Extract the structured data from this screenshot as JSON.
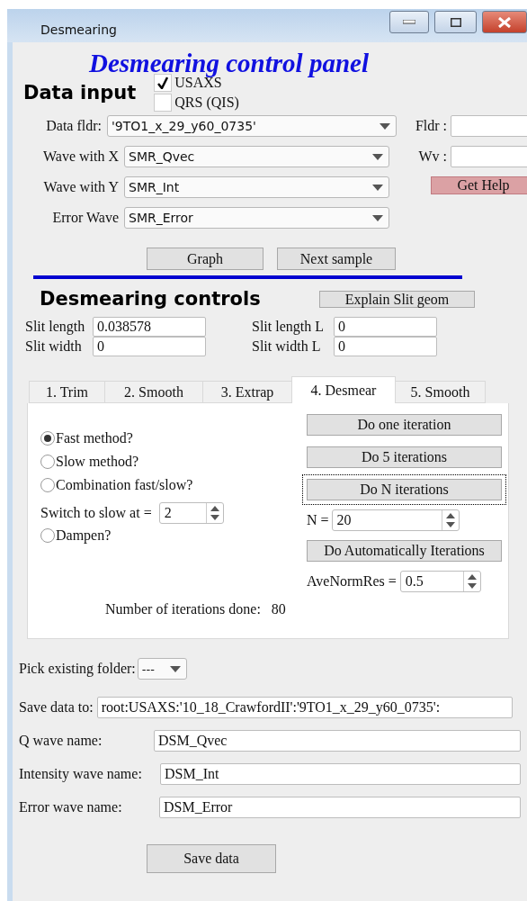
{
  "window": {
    "title": "Desmearing"
  },
  "heading": "Desmearing control panel",
  "data_input": {
    "title": "Data input",
    "checkboxes": [
      {
        "label": "USAXS",
        "checked": true
      },
      {
        "label": "QRS (QIS)",
        "checked": false
      }
    ],
    "selects": [
      {
        "label": "Data fldr:",
        "value": "'9TO1_x_29_y60_0735'"
      },
      {
        "label": "Wave with X",
        "value": "SMR_Qvec"
      },
      {
        "label": "Wave with Y",
        "value": "SMR_Int"
      },
      {
        "label": "Error Wave",
        "value": "SMR_Error"
      }
    ],
    "side_fields": [
      {
        "label": "Fldr :"
      },
      {
        "label": "Wv :"
      }
    ],
    "help_button": "Get Help",
    "buttons": [
      "Graph",
      "Next sample"
    ]
  },
  "desmearing": {
    "title": "Desmearing controls",
    "explain_button": "Explain Slit geom",
    "slit_fields": [
      {
        "label": "Slit length",
        "value": "0.038578"
      },
      {
        "label": "Slit width",
        "value": "0"
      },
      {
        "label": "Slit length L",
        "value": "0"
      },
      {
        "label": "Slit width L",
        "value": "0"
      }
    ]
  },
  "tabs": [
    {
      "label": "1. Trim",
      "selected": false
    },
    {
      "label": "2. Smooth",
      "selected": false
    },
    {
      "label": "3. Extrap",
      "selected": false
    },
    {
      "label": "4. Desmear",
      "selected": true
    },
    {
      "label": "5. Smooth",
      "selected": false
    }
  ],
  "methods": [
    {
      "label": "Fast method?",
      "selected": true
    },
    {
      "label": "Slow method?",
      "selected": false
    },
    {
      "label": "Combination fast/slow?",
      "selected": false
    }
  ],
  "switch_field": {
    "label": "Switch to slow at =",
    "value": "2"
  },
  "dampen": {
    "label": "Dampen?",
    "checked": false
  },
  "iteration_buttons": [
    {
      "label": "Do one iteration",
      "focused": false
    },
    {
      "label": "Do 5 iterations",
      "focused": false
    },
    {
      "label": "Do N iterations",
      "focused": true
    }
  ],
  "n_field": {
    "label": "N =",
    "value": "20"
  },
  "auto_button": "Do Automatically Iterations",
  "avenormres": {
    "label": "AveNormRes =",
    "value": "0.5"
  },
  "iterations_done": {
    "label": "Number of iterations done:",
    "value": "80"
  },
  "output": {
    "folder_picker": {
      "label": "Pick existing folder:",
      "value": "---"
    },
    "fields": [
      {
        "label": "Save data to:",
        "value": "root:USAXS:'10_18_CrawfordII':'9TO1_x_29_y60_0735':"
      },
      {
        "label": "Q wave name:",
        "value": "DSM_Qvec"
      },
      {
        "label": "Intensity wave name:",
        "value": "DSM_Int"
      },
      {
        "label": "Error wave name:",
        "value": "DSM_Error"
      }
    ],
    "save_button": "Save data"
  }
}
